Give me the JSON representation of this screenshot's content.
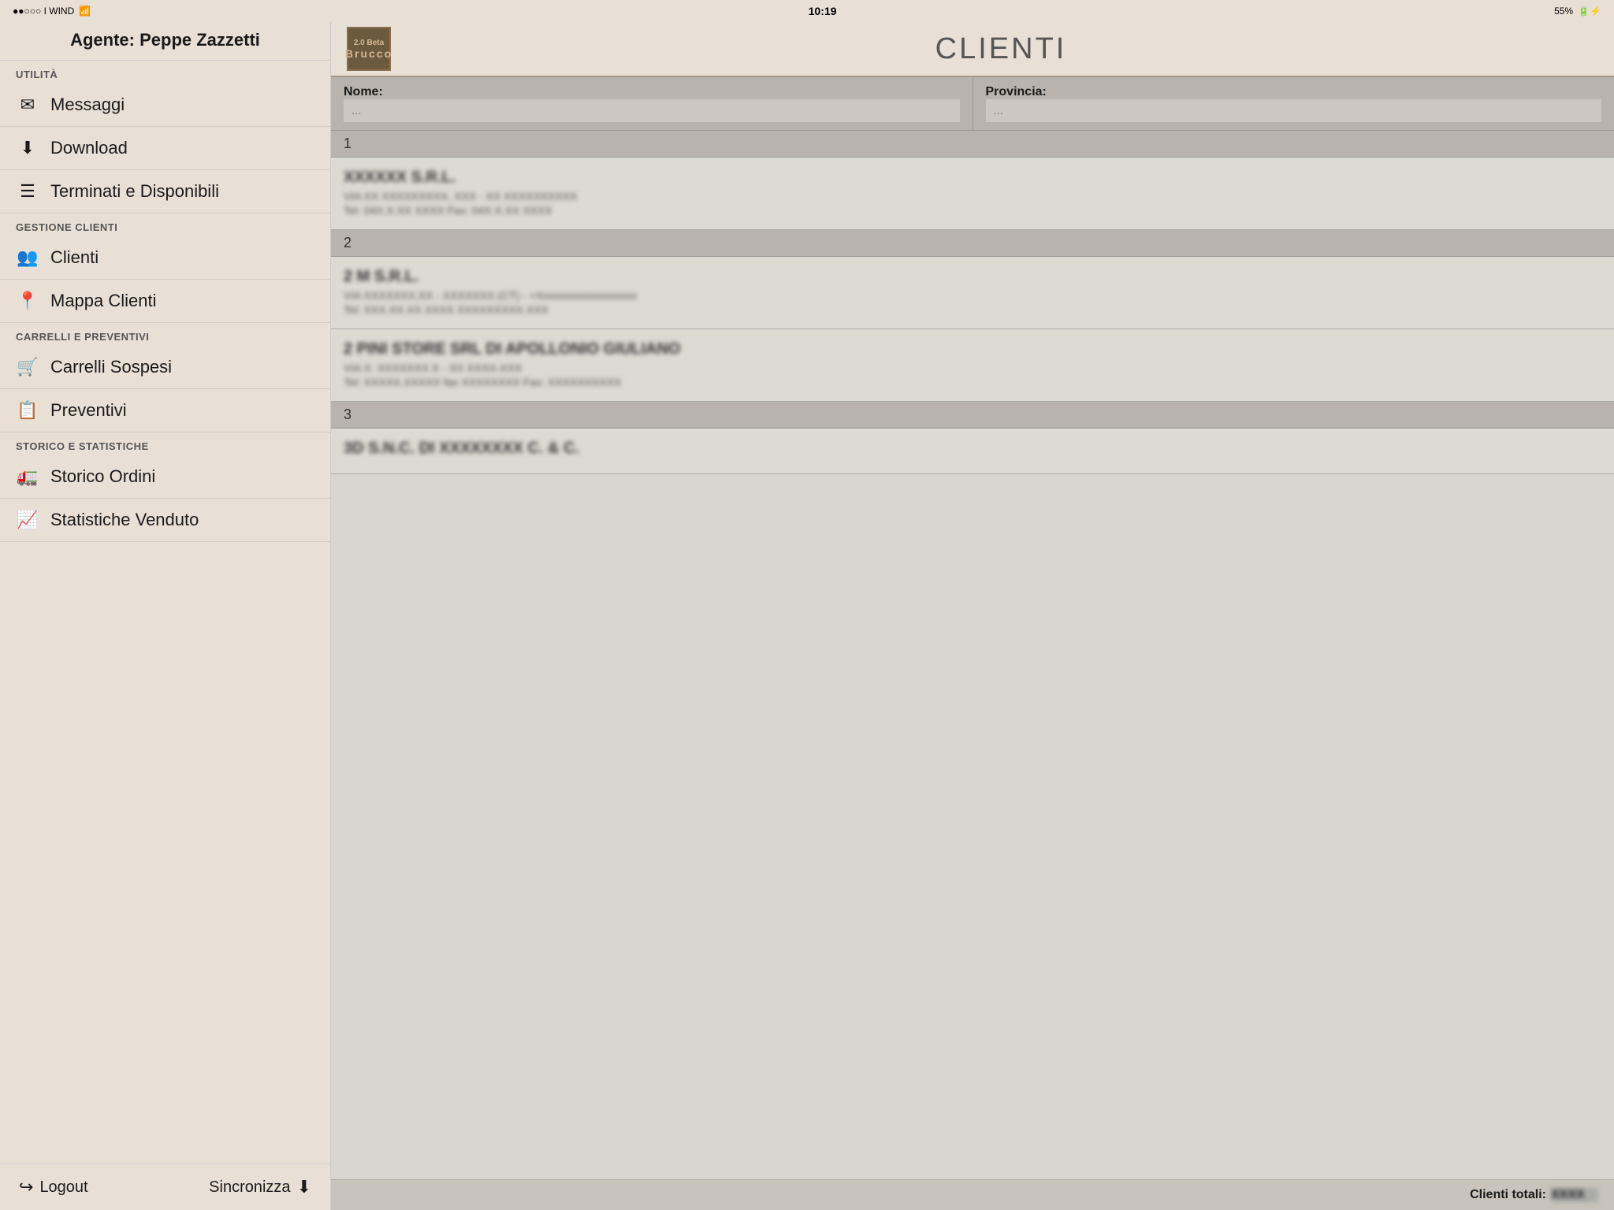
{
  "statusBar": {
    "carrier": "●●○○○ I WIND",
    "wifi": "wifi",
    "time": "10:19",
    "battery": "55%",
    "batteryIcon": "🔋"
  },
  "sidebar": {
    "agentLabel": "Agente: Peppe Zazzetti",
    "sections": [
      {
        "label": "UTILITÀ",
        "items": [
          {
            "id": "messaggi",
            "icon": "✉",
            "label": "Messaggi"
          },
          {
            "id": "download",
            "icon": "⬇",
            "label": "Download"
          },
          {
            "id": "terminati",
            "icon": "☰",
            "label": "Terminati e Disponibili"
          }
        ]
      },
      {
        "label": "GESTIONE CLIENTI",
        "items": [
          {
            "id": "clienti",
            "icon": "👥",
            "label": "Clienti"
          },
          {
            "id": "mappa",
            "icon": "📍",
            "label": "Mappa Clienti"
          }
        ]
      },
      {
        "label": "CARRELLI E PREVENTIVI",
        "items": [
          {
            "id": "carrelli",
            "icon": "🛒",
            "label": "Carrelli Sospesi"
          },
          {
            "id": "preventivi",
            "icon": "📋",
            "label": "Preventivi"
          }
        ]
      },
      {
        "label": "STORICO E STATISTICHE",
        "items": [
          {
            "id": "storico",
            "icon": "🚛",
            "label": "Storico Ordini"
          },
          {
            "id": "statistiche",
            "icon": "📈",
            "label": "Statistiche Venduto"
          }
        ]
      }
    ],
    "footer": {
      "logoutLabel": "Logout",
      "logoutIcon": "↪",
      "syncLabel": "Sincronizza",
      "syncIcon": "⬇"
    }
  },
  "main": {
    "logoTextTop": "2.0 Beta",
    "logoTextMain": "Brucco",
    "pageTitle": "CLIENTI",
    "filterRow": {
      "nameLabel": "Nome:",
      "namePlaceholder": "...",
      "provinciaLabel": "Provincia:",
      "provinciaPlaceholder": "..."
    },
    "sections": [
      {
        "number": "1",
        "clients": [
          {
            "name": "XXXXXX S.R.L.",
            "address": "VIA XX XXXXXXXXX, XXX - XX XXXXXXXXXX",
            "phone": "Tel: 04X.X.XX XXXX Fax: 04X.X.XX XXXX"
          }
        ]
      },
      {
        "number": "2",
        "clients": [
          {
            "name": "2 M S.R.L.",
            "address": "VIA XXXXXXX.XX - XXXXXXX (CT) - +Xxxxxxxxxxxxxxxxxx",
            "phone": "Tel: XXX.XX.XX XXXX XXXXXXXXX.XXX"
          },
          {
            "name": "2 PINI STORE SRL DI APOLLONIO GIULIANO",
            "address": "VIA X. XXXXXXX X - XX XXXX-XXX",
            "phone": "Tel: XXXXX.XXXXX fax XXXXXXXX Fax: XXXXXXXXXX"
          }
        ]
      },
      {
        "number": "3",
        "clients": [
          {
            "name": "3D S.N.C. DI XXXXXXXX C. & C.",
            "address": "",
            "phone": ""
          }
        ]
      }
    ],
    "footer": {
      "totaliLabel": "Clienti totali:",
      "totaliValue": "XXXX"
    }
  }
}
